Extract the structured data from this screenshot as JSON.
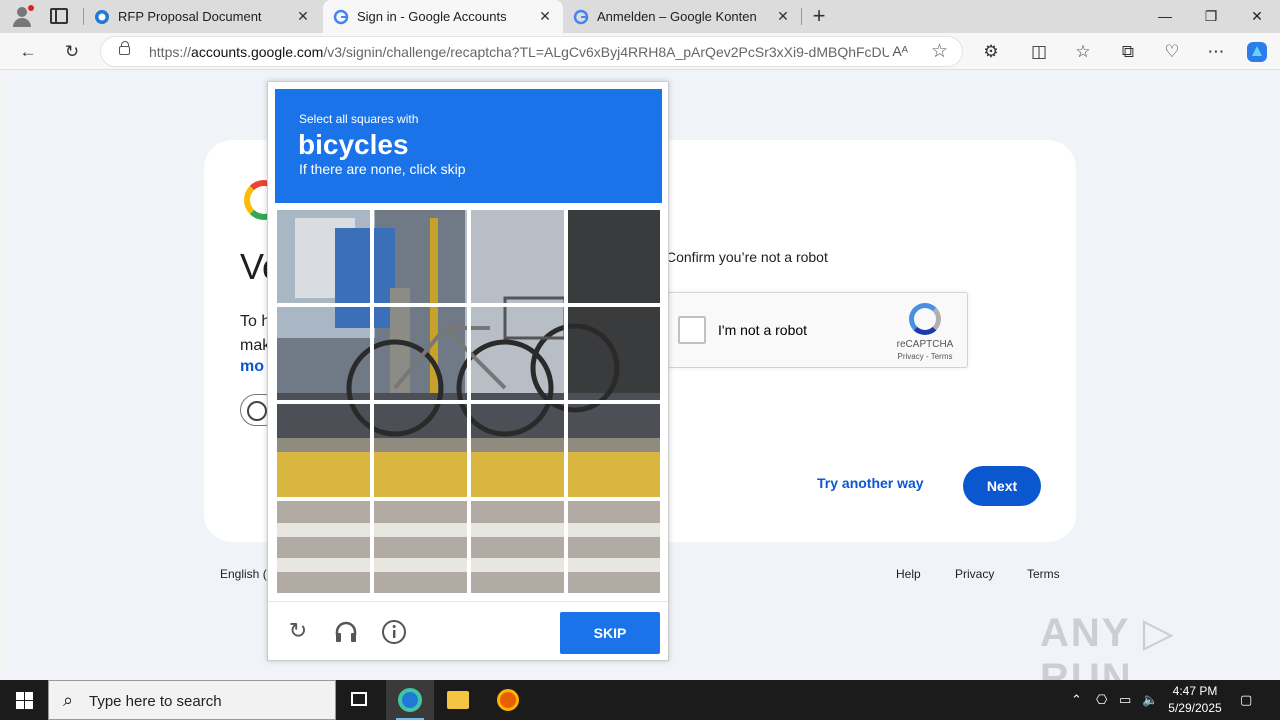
{
  "browser": {
    "tabs": [
      {
        "title": "RFP Proposal Document",
        "active": false
      },
      {
        "title": "Sign in - Google Accounts",
        "active": true
      },
      {
        "title": "Anmelden – Google Konten",
        "active": false
      }
    ],
    "close_glyph": "✕",
    "new_tab_glyph": "+",
    "window_controls": {
      "minimize": "—",
      "maximize": "❐",
      "close": "✕"
    },
    "url_host": "accounts.google.com",
    "url_prefix": "https://",
    "url_rest": "/v3/signin/challenge/recaptcha?TL=ALgCv6xByj4RRH8A_pArQev2PcSr3xXi9-dMBQhFcDU...",
    "reader_glyph": "Aᴬ"
  },
  "signin": {
    "title_partial": "Ve",
    "text_line1": "To h",
    "text_line2": "mak",
    "link_partial": "mo",
    "confirm_label": "Confirm you’re not a robot",
    "checkbox_label": "I'm not a robot",
    "recaptcha_label": "reCAPTCHA",
    "recaptcha_links": "Privacy - Terms",
    "try_another": "Try another way",
    "next": "Next"
  },
  "footer": {
    "language": "English (",
    "links": [
      "Help",
      "Privacy",
      "Terms"
    ]
  },
  "challenge": {
    "instruction": "Select all squares with",
    "target": "bicycles",
    "hint": "If there are none, click skip",
    "skip": "SKIP",
    "grid": {
      "rows": 4,
      "cols": 4
    }
  },
  "watermark": "ANY ▷ RUN",
  "taskbar": {
    "search_placeholder": "Type here to search",
    "time": "4:47 PM",
    "date": "5/29/2025"
  },
  "colors": {
    "accent": "#1a73e8",
    "google_blue": "#0b57d0",
    "page_bg": "#f0f4f9"
  }
}
